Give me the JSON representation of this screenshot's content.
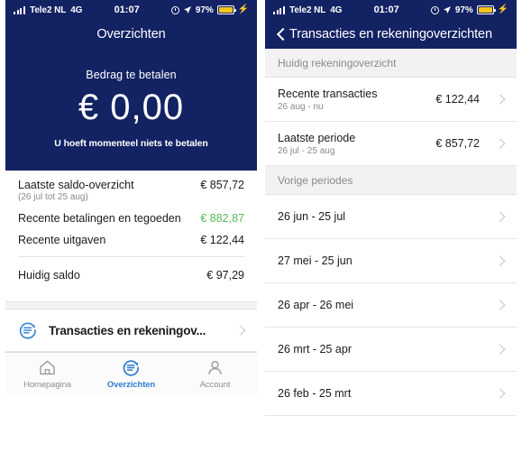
{
  "status_bar": {
    "carrier": "Tele2 NL",
    "network": "4G",
    "time": "01:07",
    "battery_pct": "97%",
    "icons": [
      "signal-bars-icon",
      "alarm-icon",
      "location-arrow-icon",
      "battery-icon",
      "charging-bolt-icon"
    ],
    "battery_color": "#f5c518"
  },
  "theme": {
    "navy": "#132263",
    "accent_blue": "#2f7dd1",
    "green": "#53b95b",
    "grey_text": "#8a8a8e"
  },
  "left_screen": {
    "nav_title": "Overzichten",
    "hero": {
      "label": "Bedrag te betalen",
      "amount": "€ 0,00",
      "note": "U hoeft momenteel niets te betalen"
    },
    "summary_rows": [
      {
        "label": "Laatste saldo-overzicht",
        "sub": "(26 jul tot 25 aug)",
        "value": "€ 857,72",
        "green": false
      },
      {
        "label": "Recente betalingen en tegoeden",
        "sub": "",
        "value": "€ 882,87",
        "green": true
      },
      {
        "label": "Recente uitgaven",
        "sub": "",
        "value": "€ 122,44",
        "green": false
      }
    ],
    "total_row": {
      "label": "Huidig saldo",
      "value": "€ 97,29"
    },
    "link_row": {
      "label": "Transacties en rekeningov...",
      "icon": "transactions-circle-icon"
    },
    "tabs": [
      {
        "label": "Homepagina",
        "icon": "home-icon",
        "active": false
      },
      {
        "label": "Overzichten",
        "icon": "transactions-circle-icon",
        "active": true
      },
      {
        "label": "Account",
        "icon": "person-icon",
        "active": false
      }
    ]
  },
  "right_screen": {
    "nav_title": "Transacties en rekeningoverzichten",
    "back_icon": "chevron-left-icon",
    "sections": [
      {
        "header": "Huidig rekeningoverzicht",
        "rows": [
          {
            "title": "Recente transacties",
            "sub": "26 aug - nu",
            "amount": "€ 122,44"
          },
          {
            "title": "Laatste periode",
            "sub": "26 jul - 25 aug",
            "amount": "€ 857,72"
          }
        ]
      },
      {
        "header": "Vorige periodes",
        "rows": [
          {
            "title": "26 jun - 25 jul",
            "sub": "",
            "amount": ""
          },
          {
            "title": "27 mei - 25 jun",
            "sub": "",
            "amount": ""
          },
          {
            "title": "26 apr - 26 mei",
            "sub": "",
            "amount": ""
          },
          {
            "title": "26 mrt - 25 apr",
            "sub": "",
            "amount": ""
          },
          {
            "title": "26 feb - 25 mrt",
            "sub": "",
            "amount": ""
          }
        ]
      }
    ]
  }
}
